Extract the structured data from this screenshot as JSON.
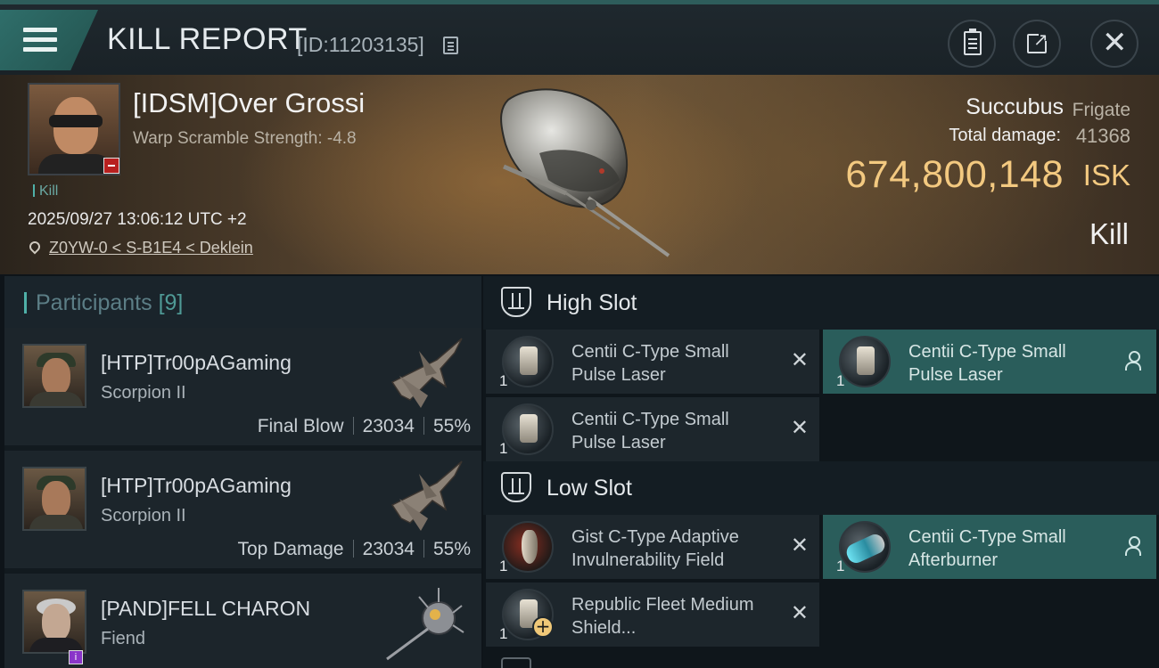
{
  "header": {
    "title": "KILL REPORT",
    "report_id": "[ID:11203135]"
  },
  "victim": {
    "name": "[IDSM]Over Grossi",
    "warp_scramble": "Warp Scramble Strength: -4.8",
    "tag": "Kill",
    "datetime": "2025/09/27 13:06:12 UTC +2",
    "location": "Z0YW-0 < S-B1E4 < Deklein",
    "ship_name": "Succubus",
    "ship_class": "Frigate",
    "damage_label": "Total damage:",
    "damage_value": "41368",
    "isk_value": "674,800,148",
    "isk_unit": "ISK",
    "result": "Kill"
  },
  "participants": {
    "label": "Participants",
    "count": "[9]",
    "items": [
      {
        "name": "[HTP]Tr00pAGaming",
        "ship": "Scorpion II",
        "role": "Final Blow",
        "damage": "23034",
        "percent": "55%"
      },
      {
        "name": "[HTP]Tr00pAGaming",
        "ship": "Scorpion II",
        "role": "Top Damage",
        "damage": "23034",
        "percent": "55%"
      },
      {
        "name": "[PAND]FELL CHARON",
        "ship": "Fiend",
        "role": "",
        "damage": "",
        "percent": ""
      }
    ]
  },
  "fitting": {
    "high_slot_label": "High Slot",
    "low_slot_label": "Low Slot",
    "high": [
      {
        "name": "Centii C-Type Small Pulse Laser",
        "qty": "1",
        "state": "destroyed"
      },
      {
        "name": "Centii C-Type Small Pulse Laser",
        "qty": "1",
        "state": "dropped"
      },
      {
        "name": "Centii C-Type Small Pulse Laser",
        "qty": "1",
        "state": "destroyed"
      }
    ],
    "low": [
      {
        "name": "Gist C-Type Adaptive Invulnerability Field",
        "qty": "1",
        "state": "destroyed"
      },
      {
        "name": "Centii C-Type Small Afterburner",
        "qty": "1",
        "state": "dropped"
      },
      {
        "name": "Republic Fleet Medium Shield...",
        "qty": "1",
        "state": "destroyed"
      }
    ]
  },
  "colors": {
    "accent": "#2a5d5b",
    "isk": "#f3c980",
    "loss_badge": "#b8201f"
  }
}
